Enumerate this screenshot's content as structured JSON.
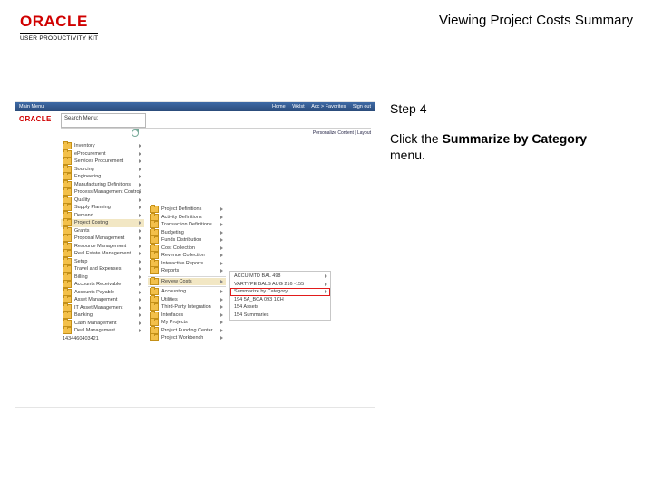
{
  "header": {
    "brand": "ORACLE",
    "subtitle": "USER PRODUCTIVITY KIT",
    "title": "Viewing Project Costs Summary"
  },
  "instruction": {
    "step_label": "Step 4",
    "pre": "Click the ",
    "bold": "Summarize by Category",
    "post": " menu."
  },
  "app": {
    "brand": "ORACLE",
    "topbar": {
      "user": "Main Menu",
      "links": [
        "Home",
        "Wklst",
        "Acc > Favorites",
        "Sign out"
      ]
    },
    "search_label": "Search Menu:",
    "personalize": "Personalize Content  |  Layout",
    "col1_end": "1434460403421",
    "col1": [
      "Inventory",
      "eProcurement",
      "Services Procurement",
      "Sourcing",
      "Engineering",
      "Manufacturing Definitions",
      "Process Management Control",
      "Quality",
      "Supply Planning",
      "Demand",
      "Project Costing",
      "Grants",
      "Proposal Management",
      "Resource Management",
      "Real Estate Management",
      "Setup",
      "Travel and Expenses",
      "Billing",
      "Accounts Receivable",
      "Accounts Payable",
      "Asset Management",
      "IT Asset Management",
      "Banking",
      "Cash Management",
      "Deal Management"
    ],
    "col1_hl_index": 10,
    "col2": [
      "Project Definitions",
      "Activity Definitions",
      "Transaction Definitions",
      "Budgeting",
      "Funds Distribution",
      "Cost Collection",
      "Revenue Collection",
      "Interactive Reports",
      "Reports",
      "Review Costs",
      "Accounting",
      "Utilities",
      "Third-Party Integration",
      "Interfaces",
      "My Projects",
      "Project Funding Center",
      "Project Workbench"
    ],
    "col2_hl_index": 9,
    "col3": [
      "ACCU MTD BAL 498",
      "VARTYPE BALS AUG 216 -155",
      "Summarize by Category",
      "194 5A_BCA 093 1CH",
      "154 Assets",
      "154 Summaries"
    ],
    "col3_red_index": 2
  }
}
